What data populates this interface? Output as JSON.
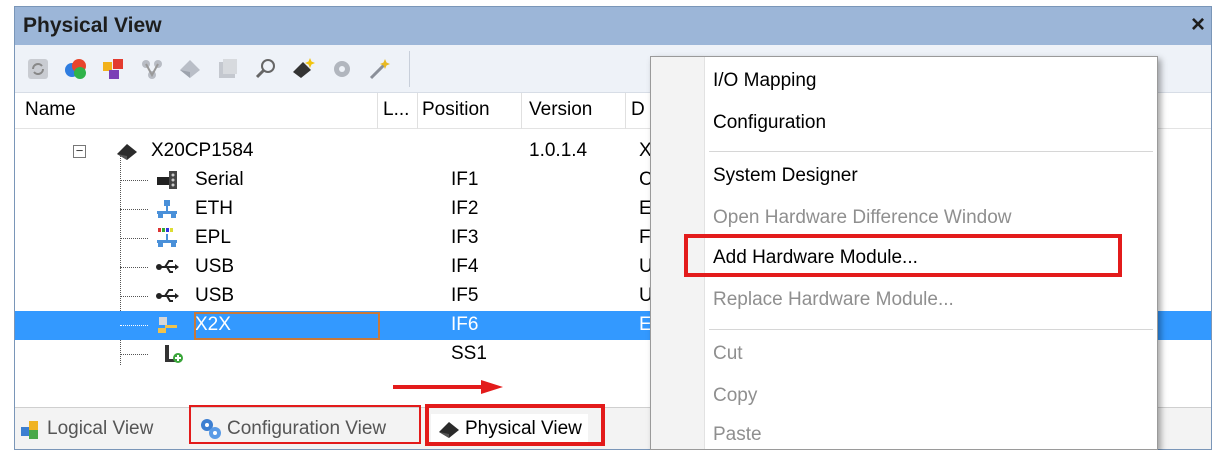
{
  "panel": {
    "title": "Physical View",
    "close_label": "×"
  },
  "toolbar": {
    "icons": [
      "refresh-icon",
      "color-palette-icon",
      "gallery-icon",
      "network-icon",
      "module-icon",
      "document-icon",
      "search-icon",
      "add-module-icon",
      "settings-gear-icon",
      "wand-icon"
    ]
  },
  "columns": {
    "name": "Name",
    "l": "L...",
    "position": "Position",
    "version": "Version",
    "d": "D"
  },
  "tree": {
    "rows": [
      {
        "name": "X20CP1584",
        "position": "",
        "version": "1.0.1.4",
        "d": "X",
        "icon": "cpu-icon"
      },
      {
        "name": "Serial",
        "position": "IF1",
        "version": "",
        "d": "C",
        "icon": "serial-port-icon"
      },
      {
        "name": "ETH",
        "position": "IF2",
        "version": "",
        "d": "E",
        "icon": "ethernet-icon"
      },
      {
        "name": "EPL",
        "position": "IF3",
        "version": "",
        "d": "F",
        "icon": "powerlink-icon"
      },
      {
        "name": "USB",
        "position": "IF4",
        "version": "",
        "d": "U",
        "icon": "usb-icon"
      },
      {
        "name": "USB",
        "position": "IF5",
        "version": "",
        "d": "U",
        "icon": "usb-icon"
      },
      {
        "name": "X2X",
        "position": "IF6",
        "version": "",
        "d": "E",
        "icon": "x2x-bus-icon",
        "selected": true
      },
      {
        "name": "",
        "position": "SS1",
        "version": "",
        "d": "",
        "icon": "slot-add-icon"
      }
    ]
  },
  "tabs": [
    {
      "label": "Logical View",
      "icon": "logical-view-icon"
    },
    {
      "label": "Configuration View",
      "icon": "configuration-view-icon"
    },
    {
      "label": "Physical View",
      "icon": "physical-view-icon",
      "active": true
    }
  ],
  "context_menu": {
    "items": [
      {
        "label": "I/O Mapping",
        "enabled": true
      },
      {
        "label": "Configuration",
        "enabled": true
      },
      {
        "label": "System Designer",
        "enabled": true
      },
      {
        "label": "Open Hardware Difference Window",
        "enabled": false
      },
      {
        "label": "Add Hardware Module...",
        "enabled": true,
        "highlighted": true
      },
      {
        "label": "Replace Hardware Module...",
        "enabled": false
      },
      {
        "label": "Cut",
        "enabled": false
      },
      {
        "label": "Copy",
        "enabled": false
      },
      {
        "label": "Paste",
        "enabled": false
      }
    ]
  },
  "colors": {
    "title_bg": "#9cb6d8",
    "selection": "#3399ff",
    "highlight_red": "#e31b1b"
  }
}
